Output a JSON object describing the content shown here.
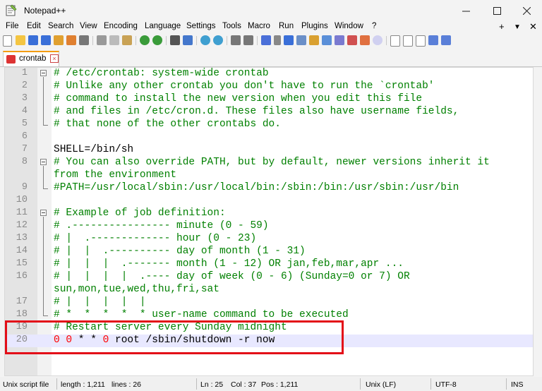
{
  "window": {
    "title": "Notepad++"
  },
  "menu": [
    "File",
    "Edit",
    "Search",
    "View",
    "Encoding",
    "Language",
    "Settings",
    "Tools",
    "Macro",
    "Run",
    "Plugins",
    "Window",
    "?"
  ],
  "menu_right": [
    "+",
    "▼",
    "✕"
  ],
  "tab": {
    "label": "crontab"
  },
  "lines": [
    {
      "n": "1",
      "segs": [
        {
          "t": "# /etc/crontab: system-wide crontab",
          "c": "comment"
        }
      ]
    },
    {
      "n": "2",
      "segs": [
        {
          "t": "# Unlike any other crontab you don't have to run the `crontab'",
          "c": "comment"
        }
      ]
    },
    {
      "n": "3",
      "segs": [
        {
          "t": "# command to install the new version when you edit this file",
          "c": "comment"
        }
      ]
    },
    {
      "n": "4",
      "segs": [
        {
          "t": "# and files in /etc/cron.d. These files also have username fields,",
          "c": "comment"
        }
      ]
    },
    {
      "n": "5",
      "segs": [
        {
          "t": "# that none of the other crontabs do.",
          "c": "comment"
        }
      ]
    },
    {
      "n": "6",
      "segs": []
    },
    {
      "n": "7",
      "segs": [
        {
          "t": "SHELL=/bin/sh",
          "c": "op"
        }
      ]
    },
    {
      "n": "8",
      "segs": [
        {
          "t": "# You can also override PATH, but by default, newer versions inherit it",
          "c": "comment"
        }
      ]
    },
    {
      "n": "",
      "segs": [
        {
          "t": "from the environment",
          "c": "comment"
        }
      ]
    },
    {
      "n": "9",
      "segs": [
        {
          "t": "#PATH=/usr/local/sbin:/usr/local/bin:/sbin:/bin:/usr/sbin:/usr/bin",
          "c": "comment"
        }
      ]
    },
    {
      "n": "10",
      "segs": []
    },
    {
      "n": "11",
      "segs": [
        {
          "t": "# Example of job definition:",
          "c": "comment"
        }
      ]
    },
    {
      "n": "12",
      "segs": [
        {
          "t": "# .---------------- minute (0 - 59)",
          "c": "comment"
        }
      ]
    },
    {
      "n": "13",
      "segs": [
        {
          "t": "# |  .------------- hour (0 - 23)",
          "c": "comment"
        }
      ]
    },
    {
      "n": "14",
      "segs": [
        {
          "t": "# |  |  .---------- day of month (1 - 31)",
          "c": "comment"
        }
      ]
    },
    {
      "n": "15",
      "segs": [
        {
          "t": "# |  |  |  .------- month (1 - 12) OR jan,feb,mar,apr ...",
          "c": "comment"
        }
      ]
    },
    {
      "n": "16",
      "segs": [
        {
          "t": "# |  |  |  |  .---- day of week (0 - 6) (Sunday=0 or 7) OR",
          "c": "comment"
        }
      ]
    },
    {
      "n": "",
      "segs": [
        {
          "t": "sun,mon,tue,wed,thu,fri,sat",
          "c": "comment"
        }
      ]
    },
    {
      "n": "17",
      "segs": [
        {
          "t": "# |  |  |  |  |",
          "c": "comment"
        }
      ]
    },
    {
      "n": "18",
      "segs": [
        {
          "t": "# *  *  *  *  * user-name command to be executed",
          "c": "comment"
        }
      ]
    },
    {
      "n": "19",
      "segs": [
        {
          "t": "# Restart server every Sunday midnight",
          "c": "comment"
        }
      ]
    },
    {
      "n": "20",
      "segs": [
        {
          "t": "0 0",
          "c": "red"
        },
        {
          "t": " * * ",
          "c": "op"
        },
        {
          "t": "0",
          "c": "red"
        },
        {
          "t": " root /sbin/shutdown -r now",
          "c": "op"
        }
      ]
    }
  ],
  "status": {
    "type": "Unix script file",
    "length": "length : 1,211",
    "lines": "lines : 26",
    "ln": "Ln : 25",
    "col": "Col : 37",
    "pos": "Pos : 1,211",
    "eol": "Unix (LF)",
    "encoding": "UTF-8",
    "mode": "INS"
  },
  "colors": {
    "comment": "#008000",
    "number": "#ff0000",
    "highlight": "#e30e18",
    "current_line": "#e8e8ff"
  }
}
